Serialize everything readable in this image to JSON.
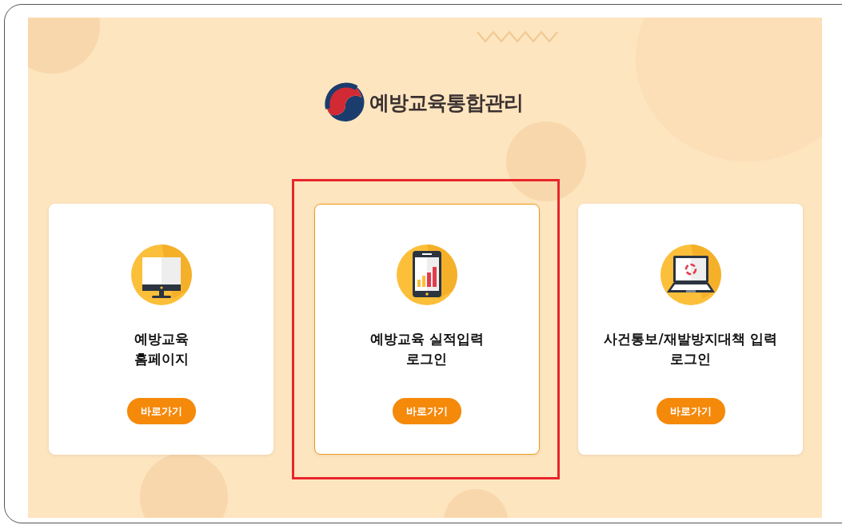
{
  "logo": {
    "title": "예방교육통합관리"
  },
  "cards": [
    {
      "kind": "monitor",
      "title": [
        "예방교육",
        "홈페이지"
      ],
      "button": "바로가기",
      "selected": false,
      "highlighted": false
    },
    {
      "kind": "tablet",
      "title": [
        "예방교육 실적입력",
        "로그인"
      ],
      "button": "바로가기",
      "selected": true,
      "highlighted": true
    },
    {
      "kind": "laptop",
      "title": [
        "사건통보/재발방지대책 입력",
        "로그인"
      ],
      "button": "바로가기",
      "selected": false,
      "highlighted": false
    }
  ]
}
